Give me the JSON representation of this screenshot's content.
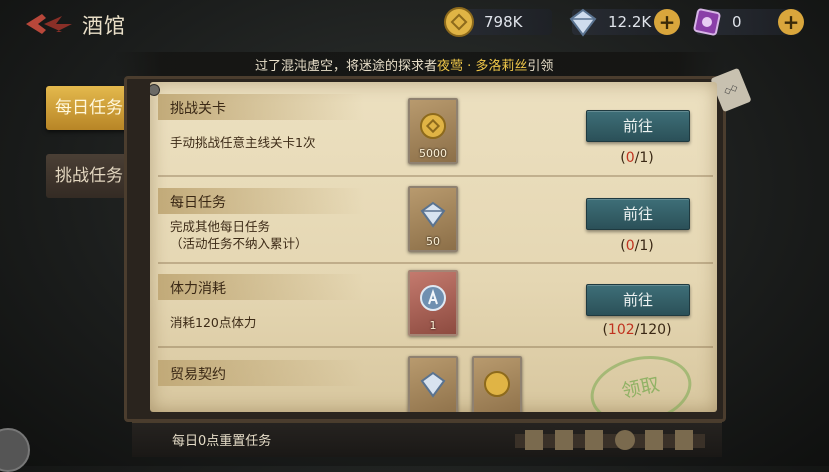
{
  "header": {
    "title": "酒馆",
    "resources": [
      {
        "icon": "gold-coin-icon",
        "value": "798K",
        "has_plus": false
      },
      {
        "icon": "diamond-icon",
        "value": "12.2K",
        "has_plus": true
      },
      {
        "icon": "purple-gem-icon",
        "value": "0",
        "has_plus": true
      }
    ],
    "plus_label": "+"
  },
  "marquee": {
    "prefix": "过了混沌虚空，将迷途的探求者",
    "highlight": "夜莺 · 多洛莉丝",
    "suffix": "引领"
  },
  "tabs": [
    {
      "label": "每日任务",
      "active": true
    },
    {
      "label": "挑战任务",
      "active": false
    }
  ],
  "tasks": [
    {
      "title": "挑战关卡",
      "desc": "手动挑战任意主线关卡1次",
      "desc2": "",
      "rewards": [
        {
          "icon": "gold-coin-icon",
          "count": "5000"
        }
      ],
      "action": "前往",
      "progress_cur": "0",
      "progress_total": "1"
    },
    {
      "title": "每日任务",
      "desc": "完成其他每日任务",
      "desc2": "（活动任务不纳入累计）",
      "rewards": [
        {
          "icon": "diamond-icon",
          "count": "50"
        }
      ],
      "action": "前往",
      "progress_cur": "0",
      "progress_total": "1"
    },
    {
      "title": "体力消耗",
      "desc": "消耗120点体力",
      "desc2": "",
      "rewards": [
        {
          "icon": "stamina-potion-icon",
          "count": "1"
        }
      ],
      "action": "前往",
      "progress_cur": "102",
      "progress_total": "120"
    },
    {
      "title": "贸易契约",
      "desc": "",
      "desc2": "",
      "rewards": [
        {
          "icon": "diamond-icon",
          "count": ""
        },
        {
          "icon": "gold-coin-icon",
          "count": ""
        }
      ],
      "action": "领取",
      "progress_cur": "",
      "progress_total": ""
    }
  ],
  "footer": {
    "reset_text": "每日0点重置任务"
  },
  "colors": {
    "accent_gold": "#d9a63c",
    "progress_red": "#c0321f",
    "button_teal": "#3e6f78"
  }
}
